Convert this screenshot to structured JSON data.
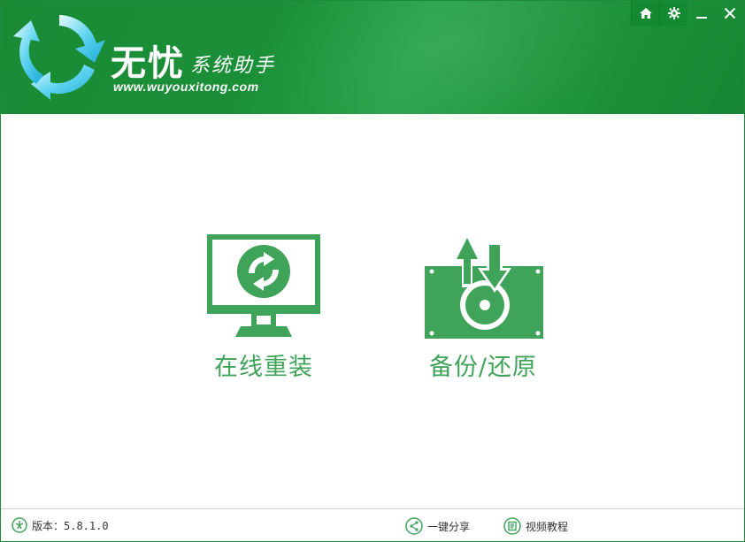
{
  "header": {
    "brand_main": "无忧",
    "brand_sub": "系统助手",
    "brand_url": "www.wuyouxitong.com"
  },
  "controls": [
    {
      "icon": "home-icon"
    },
    {
      "icon": "gear-icon"
    },
    {
      "icon": "minimize-icon"
    },
    {
      "icon": "close-icon"
    }
  ],
  "features": {
    "reinstall": {
      "label": "在线重装",
      "icon": "monitor-refresh-icon"
    },
    "backup": {
      "label": "备份/还原",
      "icon": "disk-backup-icon"
    }
  },
  "footer": {
    "version_label": "版本：5.8.1.0",
    "share_label": "一键分享",
    "video_label": "视频教程"
  },
  "colors": {
    "header_green": "#1b8f38",
    "accent_green": "#3fa35a"
  }
}
